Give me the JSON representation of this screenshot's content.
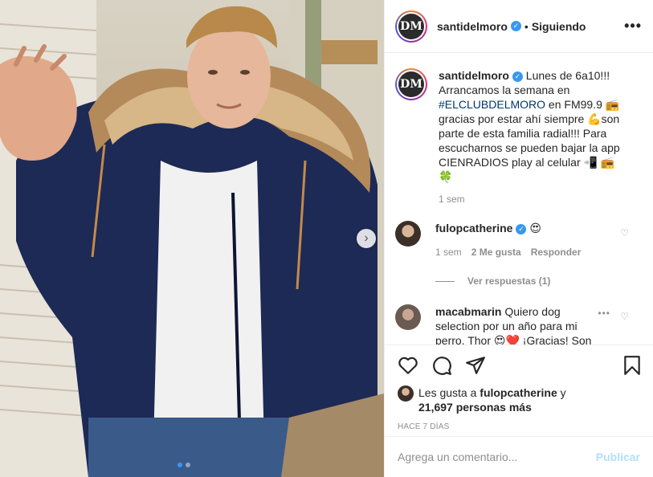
{
  "post": {
    "image_alt": "Hombre con campera azul con capucha de piel saludando",
    "carousel_dots": 2
  },
  "header": {
    "username": "santidelmoro",
    "separator": "•",
    "follow_state": "Siguiendo",
    "more_icon": "more-horizontal-icon"
  },
  "caption": {
    "username": "santidelmoro",
    "text_before": " Lunes de 6a10!!! Arrancamos la semana en ",
    "hashtag": "#ELCLUBDELMORO",
    "text_after": " en FM99.9 📻 gracias por estar ahí siempre 💪son parte de esta familia radial!!! Para escucharnos se pueden bajar la app CIENRADIOS play al celular 📲 📻🍀",
    "time": "1 sem"
  },
  "comments": [
    {
      "username": "fulopcatherine",
      "text": " 😍",
      "time": "1 sem",
      "likes": "2 Me gusta",
      "reply_label": "Responder",
      "view_replies": "Ver respuestas (1)"
    },
    {
      "username": "macabmarin",
      "text": " Quiero dog selection por un año para mi perro, Thor 😍❤️ ¡Gracias! Son"
    }
  ],
  "likes": {
    "prefix": "Les gusta a ",
    "first_user": "fulopcatherine",
    "middle": " y",
    "count": "21,697 personas más"
  },
  "timestamp": "HACE 7 DÍAS",
  "add_comment": {
    "placeholder": "Agrega un comentario...",
    "publish_label": "Publicar"
  },
  "colors": {
    "link_blue": "#00376b",
    "verified_blue": "#3897f0",
    "muted": "#8e8e8e",
    "publish_disabled": "#b2dffc"
  }
}
